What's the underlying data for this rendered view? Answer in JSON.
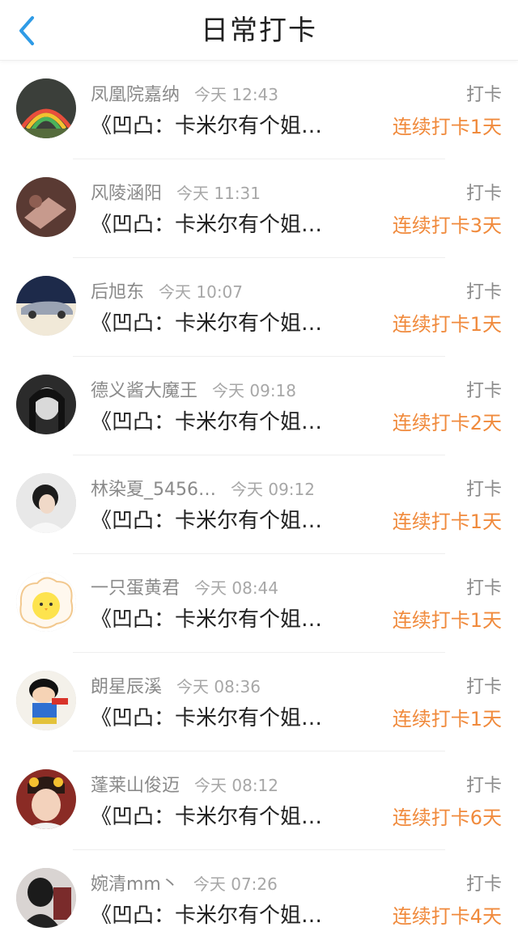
{
  "header": {
    "title": "日常打卡"
  },
  "colors": {
    "accent": "#f08a3c",
    "back": "#2f9be6"
  },
  "items": [
    {
      "name": "凤凰院嘉纳",
      "time": "今天 12:43",
      "action": "打卡",
      "book": "《凹凸：卡米尔有个姐…",
      "streak": "连续打卡1天"
    },
    {
      "name": "风陵涵阳",
      "time": "今天 11:31",
      "action": "打卡",
      "book": "《凹凸：卡米尔有个姐…",
      "streak": "连续打卡3天"
    },
    {
      "name": "后旭东",
      "time": "今天 10:07",
      "action": "打卡",
      "book": "《凹凸：卡米尔有个姐…",
      "streak": "连续打卡1天"
    },
    {
      "name": "德义酱大魔王",
      "time": "今天 09:18",
      "action": "打卡",
      "book": "《凹凸：卡米尔有个姐…",
      "streak": "连续打卡2天"
    },
    {
      "name": "林染夏_5456…",
      "time": "今天 09:12",
      "action": "打卡",
      "book": "《凹凸：卡米尔有个姐…",
      "streak": "连续打卡1天"
    },
    {
      "name": "一只蛋黄君",
      "time": "今天 08:44",
      "action": "打卡",
      "book": "《凹凸：卡米尔有个姐…",
      "streak": "连续打卡1天"
    },
    {
      "name": "朗星辰溪",
      "time": "今天 08:36",
      "action": "打卡",
      "book": "《凹凸：卡米尔有个姐…",
      "streak": "连续打卡1天"
    },
    {
      "name": "蓬莱山俊迈",
      "time": "今天 08:12",
      "action": "打卡",
      "book": "《凹凸：卡米尔有个姐…",
      "streak": "连续打卡6天"
    },
    {
      "name": "婉清mm丶",
      "time": "今天 07:26",
      "action": "打卡",
      "book": "《凹凸：卡米尔有个姐…",
      "streak": "连续打卡4天"
    }
  ]
}
